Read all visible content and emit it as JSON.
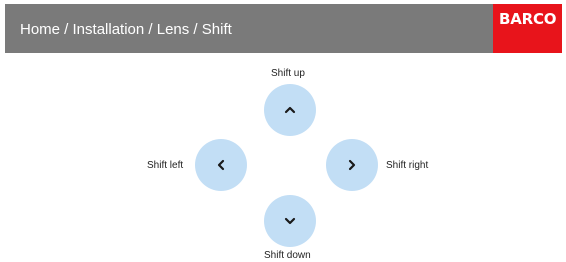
{
  "header": {
    "breadcrumb": "Home / Installation / Lens / Shift",
    "logo_text": "BARCO",
    "background_color": "#7a7a7a",
    "logo_color": "#e8141b"
  },
  "controls": {
    "button_color": "#c2def5",
    "up": {
      "label": "Shift up",
      "icon": "chevron-up-icon"
    },
    "left": {
      "label": "Shift left",
      "icon": "chevron-left-icon"
    },
    "right": {
      "label": "Shift right",
      "icon": "chevron-right-icon"
    },
    "down": {
      "label": "Shift down",
      "icon": "chevron-down-icon"
    }
  }
}
